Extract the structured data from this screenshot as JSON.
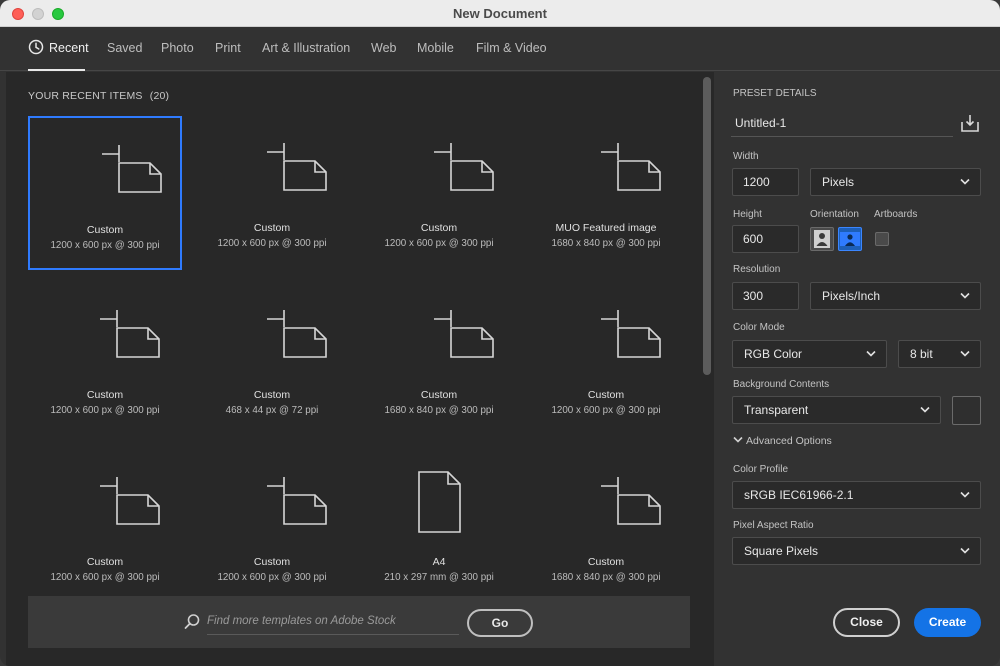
{
  "window": {
    "title": "New Document"
  },
  "tabs": [
    {
      "label": "Recent",
      "active": true
    },
    {
      "label": "Saved"
    },
    {
      "label": "Photo"
    },
    {
      "label": "Print"
    },
    {
      "label": "Art & Illustration"
    },
    {
      "label": "Web"
    },
    {
      "label": "Mobile"
    },
    {
      "label": "Film & Video"
    }
  ],
  "recent": {
    "heading": "YOUR RECENT ITEMS",
    "count": "(20)",
    "items": [
      {
        "name": "Custom",
        "size": "1200 x 600 px @ 300 ppi",
        "icon": "document-landscape-icon",
        "selected": true
      },
      {
        "name": "Custom",
        "size": "1200 x 600 px @ 300 ppi",
        "icon": "document-landscape-icon"
      },
      {
        "name": "Custom",
        "size": "1200 x 600 px @ 300 ppi",
        "icon": "document-landscape-icon"
      },
      {
        "name": "MUO Featured image",
        "size": "1680 x 840 px @ 300 ppi",
        "icon": "document-landscape-icon"
      },
      {
        "name": "Custom",
        "size": "1200 x 600 px @ 300 ppi",
        "icon": "document-landscape-icon"
      },
      {
        "name": "Custom",
        "size": "468 x 44 px @ 72 ppi",
        "icon": "document-landscape-icon"
      },
      {
        "name": "Custom",
        "size": "1680 x 840 px @ 300 ppi",
        "icon": "document-landscape-icon"
      },
      {
        "name": "Custom",
        "size": "1200 x 600 px @ 300 ppi",
        "icon": "document-landscape-icon"
      },
      {
        "name": "Custom",
        "size": "1200 x 600 px @ 300 ppi",
        "icon": "document-landscape-icon"
      },
      {
        "name": "Custom",
        "size": "1200 x 600 px @ 300 ppi",
        "icon": "document-landscape-icon"
      },
      {
        "name": "A4",
        "size": "210 x 297 mm @ 300 ppi",
        "icon": "document-portrait-icon"
      },
      {
        "name": "Custom",
        "size": "1680 x 840 px @ 300 ppi",
        "icon": "document-landscape-icon"
      }
    ]
  },
  "stock": {
    "placeholder": "Find more templates on Adobe Stock",
    "go_label": "Go"
  },
  "preset": {
    "heading": "PRESET DETAILS",
    "name": "Untitled-1",
    "width_label": "Width",
    "width_value": "1200",
    "width_unit": "Pixels",
    "height_label": "Height",
    "height_value": "600",
    "orientation_label": "Orientation",
    "orientation_selected": "landscape",
    "artboards_label": "Artboards",
    "artboards_checked": false,
    "resolution_label": "Resolution",
    "resolution_value": "300",
    "resolution_unit": "Pixels/Inch",
    "color_mode_label": "Color Mode",
    "color_mode": "RGB Color",
    "bit_depth": "8 bit",
    "background_label": "Background Contents",
    "background": "Transparent",
    "advanced_label": "Advanced Options",
    "color_profile_label": "Color Profile",
    "color_profile": "sRGB IEC61966-2.1",
    "pixel_aspect_label": "Pixel Aspect Ratio",
    "pixel_aspect": "Square Pixels"
  },
  "actions": {
    "close_label": "Close",
    "create_label": "Create"
  },
  "colors": {
    "accent": "#1473e6",
    "selection": "#2f7bff",
    "panel": "#282828"
  }
}
